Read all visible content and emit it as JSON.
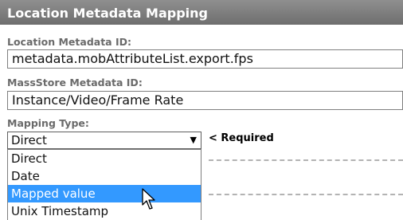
{
  "panel": {
    "title": "Location Metadata Mapping"
  },
  "location_metadata": {
    "label": "Location Metadata ID:",
    "value": "metadata.mobAttributeList.export.fps"
  },
  "massstore_metadata": {
    "label": "MassStore Metadata ID:",
    "value": "Instance/Video/Frame Rate"
  },
  "mapping_type": {
    "label": "Mapping Type:",
    "selected_value": "Direct",
    "required_text": "< Required",
    "options": [
      "Direct",
      "Date",
      "Mapped value",
      "Unix Timestamp"
    ],
    "highlighted_option": "Mapped value"
  },
  "icons": {
    "select_arrow": "chevron-down-icon",
    "pointer": "mouse-pointer-icon"
  },
  "colors": {
    "header_bg": "#7f7f7f",
    "highlight": "#3399ff",
    "label": "#6a6a6a"
  }
}
